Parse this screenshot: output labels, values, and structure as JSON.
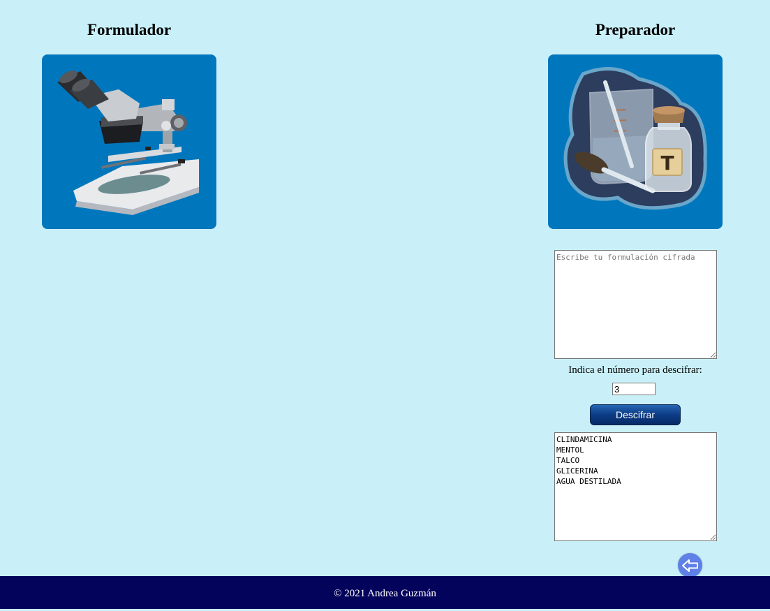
{
  "left_column": {
    "title": "Formulador",
    "image_icon": "microscope-icon"
  },
  "right_column": {
    "title": "Preparador",
    "image_icon": "lab-glassware-icon"
  },
  "cipher_input": {
    "placeholder": "Escribe tu formulación cifrada",
    "value": ""
  },
  "shift_label": "Indica el número para descifrar:",
  "shift_value": "3",
  "decipher_button_label": "Descifrar",
  "output_text": "CLINDAMICINA\nMENTOL\nTALCO\nGLICERINA\nAGUA DESTILADA",
  "back_button_icon": "arrow-left-icon",
  "footer_text": "© 2021 Andrea Guzmán",
  "colors": {
    "background": "#c9f0f8",
    "card": "#0077bd",
    "button": "#0d3b85",
    "footer": "#03035c",
    "back_button": "#5f80e6"
  }
}
